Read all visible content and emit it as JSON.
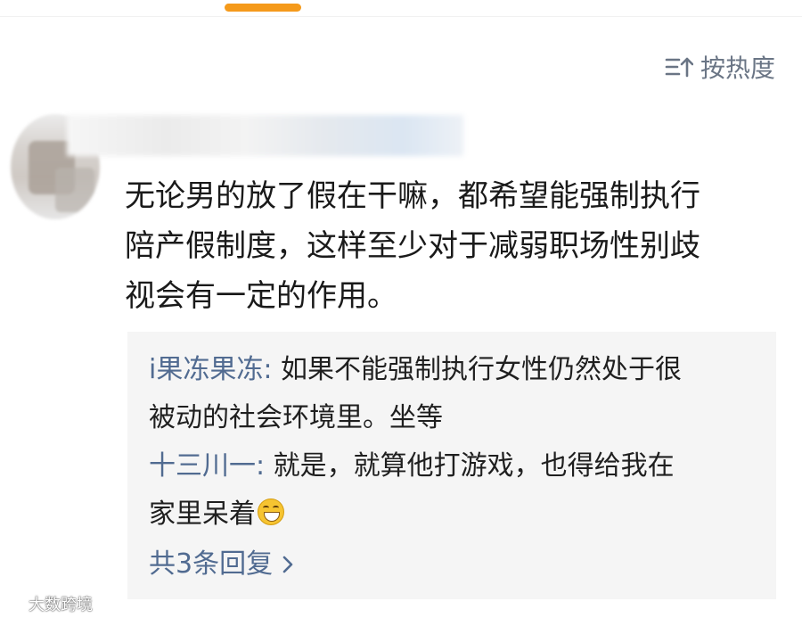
{
  "sort": {
    "label": "按热度",
    "icon": "sort-icon"
  },
  "comment": {
    "avatar": "avatar-blurred",
    "lines": [
      "无论男的放了假在干嘛，都希望能强制执行",
      "陪产假制度，这样至少对于减弱职场性别歧",
      "视会有一定的作用。"
    ]
  },
  "replies": [
    {
      "user": "i果冻果冻",
      "sep": ": ",
      "line1": "如果不能强制执行女性仍然处于很",
      "line2": "被动的社会环境里。坐等"
    },
    {
      "user": "十三川一",
      "sep": ": ",
      "line1": "就是，就算他打游戏，也得给我在",
      "line2": "家里呆着",
      "emoji": "grinning-emoji"
    }
  ],
  "more": {
    "label": "共3条回复",
    "icon": "chevron-right-icon"
  },
  "watermark": {
    "text": "大数跨境"
  },
  "colors": {
    "accent_orange": "#f59a1b",
    "link_blue": "#516b91",
    "sort_gray": "#6a7585",
    "reply_bg": "#f5f5f5",
    "text": "#1a1a1a"
  }
}
